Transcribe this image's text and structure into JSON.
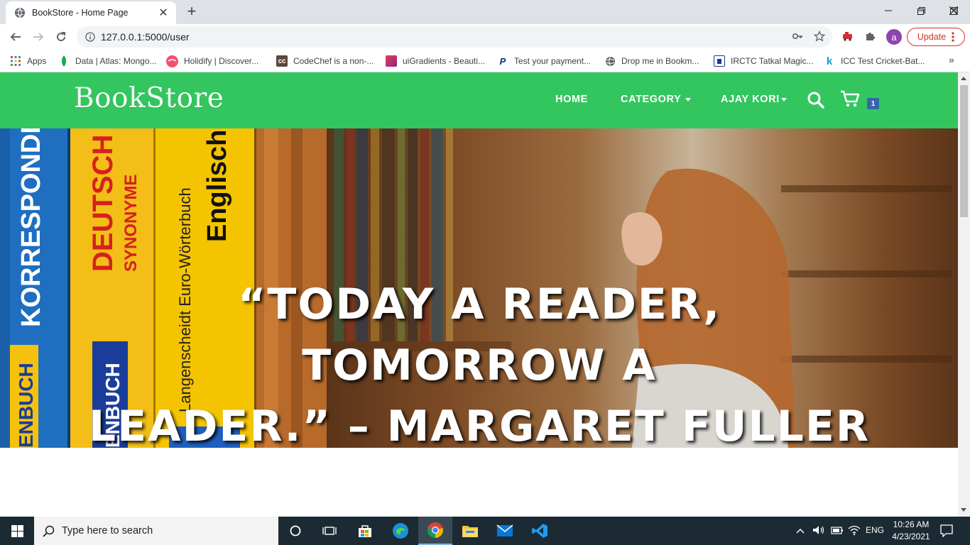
{
  "browser": {
    "tab_title": "BookStore - Home Page",
    "url": "127.0.0.1:5000/user",
    "profile_initial": "a",
    "update_label": "Update",
    "bookmarks": [
      {
        "label": "Apps",
        "icon": "apps-grid-icon"
      },
      {
        "label": "Data | Atlas: Mongo...",
        "icon": "mongodb-leaf-icon"
      },
      {
        "label": "Holidify | Discover...",
        "icon": "holidify-icon"
      },
      {
        "label": "CodeChef is a non-...",
        "icon": "codechef-icon"
      },
      {
        "label": "uiGradients - Beauti...",
        "icon": "uigradients-icon"
      },
      {
        "label": "Test your payment...",
        "icon": "paypal-icon"
      },
      {
        "label": "Drop me in Bookm...",
        "icon": "globe-icon"
      },
      {
        "label": "IRCTC Tatkal Magic...",
        "icon": "irctc-icon"
      },
      {
        "label": "ICC Test Cricket-Bat...",
        "icon": "k-icon"
      }
    ]
  },
  "site": {
    "logo": "BookStore",
    "nav": {
      "home": "HOME",
      "category": "CATEGORY",
      "user": "AJAY KORI"
    },
    "cart_count": "1",
    "hero_quote_line1": "“TODAY A READER, TOMORROW A",
    "hero_quote_line2": "LEADER.” – MARGARET FULLER",
    "hero_books": [
      "KORRESPONDENZ",
      "DEUTSCH",
      "SYNONYME",
      "Langenscheidt Euro-Wörterbuch",
      "Englisch",
      "ENBUCH",
      "ENBUCH"
    ]
  },
  "taskbar": {
    "search_placeholder": "Type here to search",
    "language": "ENG",
    "time": "10:26 AM",
    "date": "4/23/2021"
  },
  "colors": {
    "brand_green": "#33c65f",
    "update_red": "#d93025",
    "badge_blue": "#3566a8"
  }
}
